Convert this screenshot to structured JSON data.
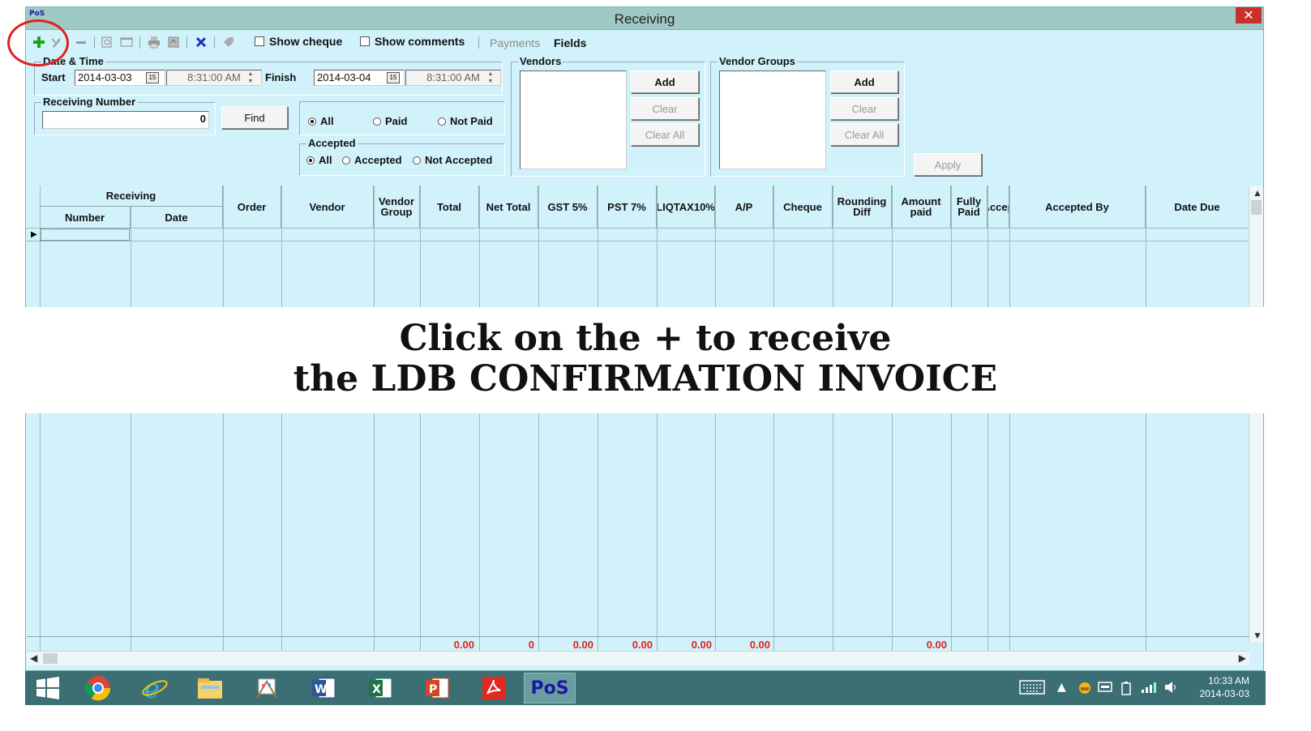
{
  "window": {
    "title": "Receiving",
    "app_logo": "PoS",
    "close_glyph": "✕"
  },
  "toolbar": {
    "show_cheque": "Show cheque",
    "show_comments": "Show comments",
    "payments": "Payments",
    "fields": "Fields"
  },
  "date_time": {
    "legend": "Date & Time",
    "start_label": "Start",
    "start_date": "2014-03-03",
    "start_time": "8:31:00 AM",
    "finish_label": "Finish",
    "finish_date": "2014-03-04",
    "finish_time": "8:31:00 AM"
  },
  "receiving_number": {
    "legend": "Receiving Number",
    "value": "0",
    "find_label": "Find"
  },
  "paid_filter": {
    "options": [
      "All",
      "Paid",
      "Not Paid"
    ],
    "selected": "All"
  },
  "accepted_filter": {
    "legend": "Accepted",
    "options": [
      "All",
      "Accepted",
      "Not Accepted"
    ],
    "selected": "All"
  },
  "vendors": {
    "legend": "Vendors",
    "add": "Add",
    "clear": "Clear",
    "clear_all": "Clear All"
  },
  "vendor_groups": {
    "legend": "Vendor Groups",
    "add": "Add",
    "clear": "Clear",
    "clear_all": "Clear All"
  },
  "apply_label": "Apply",
  "grid": {
    "group_header": "Receiving",
    "columns": [
      "Number",
      "Date",
      "Order",
      "Vendor",
      "Vendor Group",
      "Total",
      "Net Total",
      "GST 5%",
      "PST 7%",
      "LIQTAX10%",
      "A/P",
      "Cheque",
      "Rounding Diff",
      "Amount paid",
      "Fully Paid",
      "Accep",
      "Accepted By",
      "Date Due"
    ],
    "totals": {
      "total": "0.00",
      "net_total": "0",
      "gst": "0.00",
      "pst": "0.00",
      "liqtax": "0.00",
      "ap": "0.00",
      "amount_paid": "0.00"
    }
  },
  "overlay": {
    "line1": "Click on the + to receive",
    "line2": "the LDB CONFIRMATION INVOICE"
  },
  "taskbar": {
    "pos_label": "PoS",
    "time": "10:33 AM",
    "date": "2014-03-03"
  },
  "colors": {
    "accent_red": "#e0211d",
    "window_bg": "#d2f2fb",
    "taskbar": "#3b6f73"
  }
}
